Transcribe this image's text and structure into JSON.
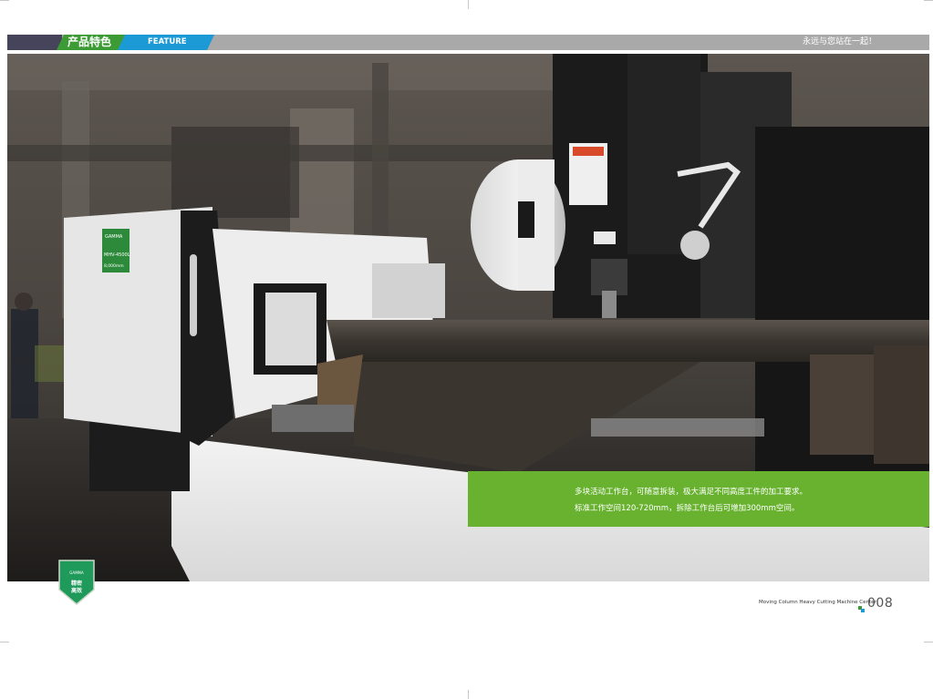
{
  "header": {
    "section_label": "产品特色",
    "section_label_en": "FEATURE",
    "slogan": "永远与您站在一起！"
  },
  "photo": {
    "description_alt": "",
    "machine_plate": {
      "brand": "GAMMA",
      "model": "MHV-4500L",
      "spec": "8,000mm"
    }
  },
  "caption": {
    "line1": "多块活动工作台，可随意拆装，极大满足不同高度工件的加工要求。",
    "line2": "标准工作空间120-720mm，拆除工作台后可增加300mm空间。"
  },
  "badge": {
    "brand": "GAMMA",
    "line1": "精密",
    "line2": "高效",
    "color": "#1f9a5a"
  },
  "footer": {
    "title": "Moving Column Heavy Cutting Machine Center",
    "page_number": "008"
  },
  "colors": {
    "header_green": "#3c9b34",
    "header_blue": "#1b9ad6",
    "caption_green": "#68b22f"
  }
}
